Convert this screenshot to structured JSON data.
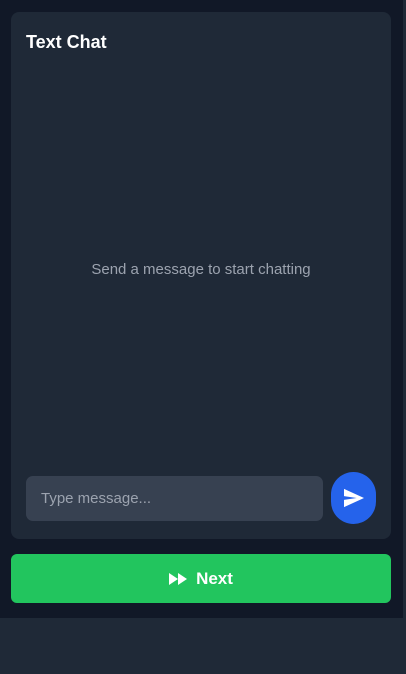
{
  "chat": {
    "title": "Text Chat",
    "empty_message": "Send a message to start chatting",
    "input_value": "",
    "input_placeholder": "Type message...",
    "send_icon": "send-icon"
  },
  "next_button": {
    "label": "Next",
    "icon": "fast-forward-icon"
  },
  "colors": {
    "background": "#111827",
    "panel": "#1f2937",
    "input": "#374151",
    "send_button": "#2563eb",
    "next_button": "#22c55e"
  }
}
